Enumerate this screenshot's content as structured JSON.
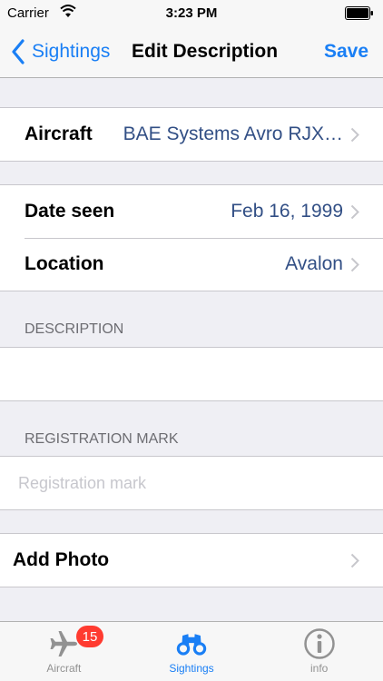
{
  "status_bar": {
    "carrier": "Carrier",
    "time": "3:23 PM",
    "icons": [
      "wifi-icon",
      "battery-icon"
    ]
  },
  "nav": {
    "back_label": "Sightings",
    "title": "Edit Description",
    "save_label": "Save"
  },
  "colors": {
    "accent": "#1a7ff5",
    "value_text": "#324f85",
    "background": "#efeff4",
    "badge": "#ff3b30"
  },
  "aircraft_row": {
    "label": "Aircraft",
    "value": "BAE Systems Avro RJX…"
  },
  "details": {
    "date_label": "Date seen",
    "date_value": "Feb 16, 1999",
    "location_label": "Location",
    "location_value": "Avalon"
  },
  "description": {
    "header": "DESCRIPTION",
    "value": ""
  },
  "registration": {
    "header": "REGISTRATION MARK",
    "placeholder": "Registration mark",
    "value": ""
  },
  "photo": {
    "label": "Add Photo"
  },
  "tabbar": {
    "tabs": [
      {
        "label": "Aircraft",
        "icon": "airplane-icon",
        "badge": "15",
        "active": false
      },
      {
        "label": "Sightings",
        "icon": "binoculars-icon",
        "active": true
      },
      {
        "label": "info",
        "icon": "info-icon",
        "active": false
      }
    ]
  }
}
